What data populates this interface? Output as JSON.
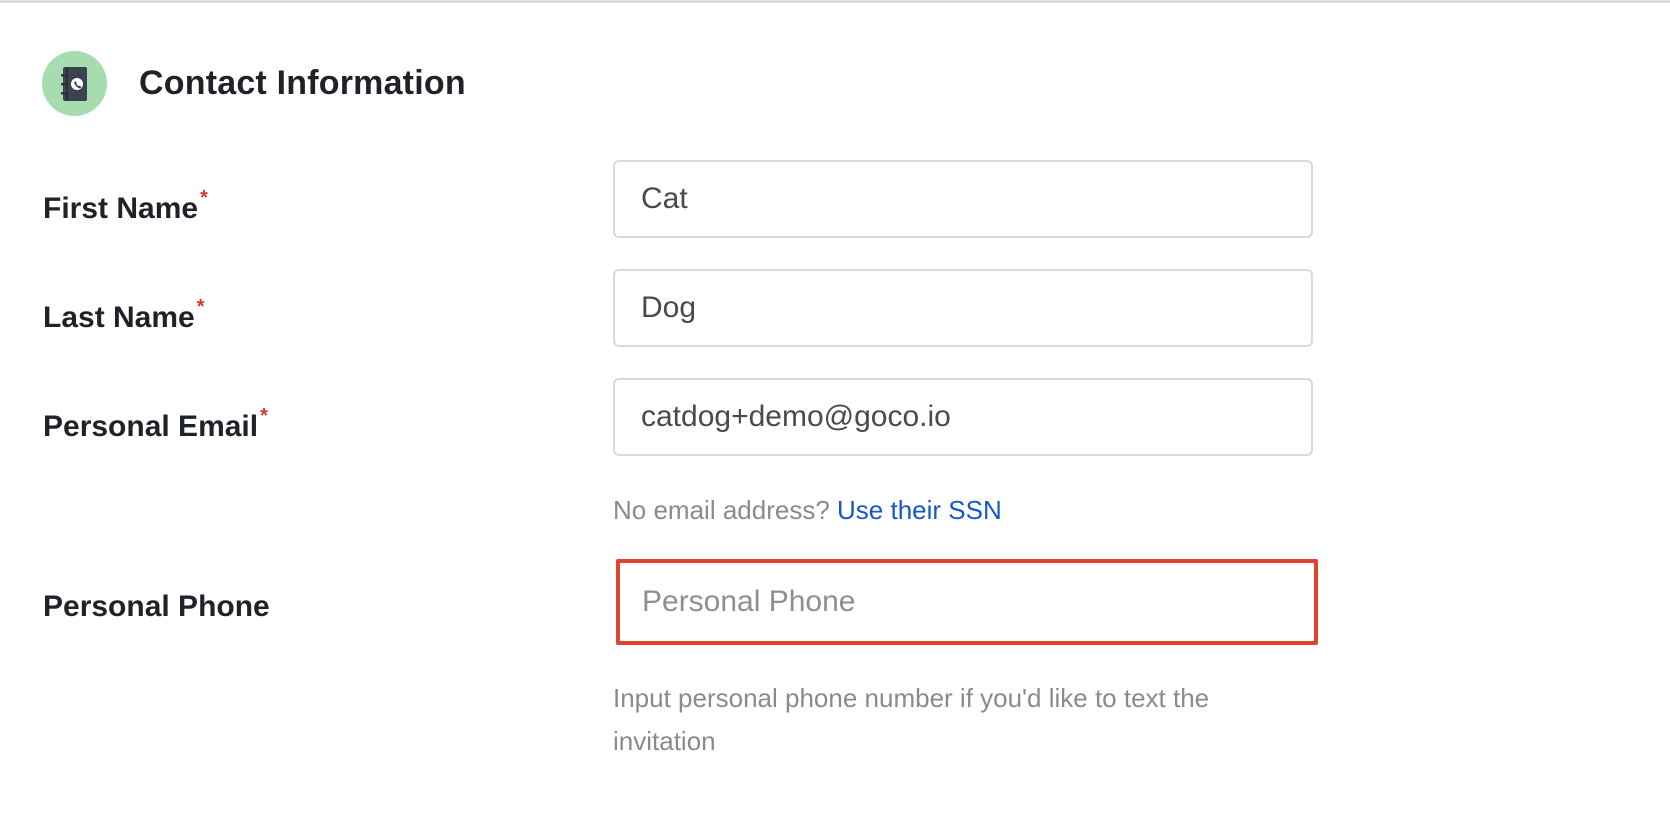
{
  "section": {
    "title": "Contact Information",
    "icon": "contact-book-icon",
    "icon_bg": "#a6dcb0"
  },
  "fields": {
    "first_name": {
      "label": "First Name",
      "required_mark": "*",
      "value": "Cat"
    },
    "last_name": {
      "label": "Last Name",
      "required_mark": "*",
      "value": "Dog"
    },
    "personal_email": {
      "label": "Personal Email",
      "required_mark": "*",
      "value": "catdog+demo@goco.io"
    },
    "personal_phone": {
      "label": "Personal Phone",
      "value": "",
      "placeholder": "Personal Phone",
      "help": "Input personal phone number if you'd like to text the invitation"
    }
  },
  "email_hint": {
    "text": "No email address?",
    "link": "Use their SSN"
  },
  "colors": {
    "required": "#d6362b",
    "link": "#1a56c8",
    "highlight_border": "#e0432e"
  }
}
